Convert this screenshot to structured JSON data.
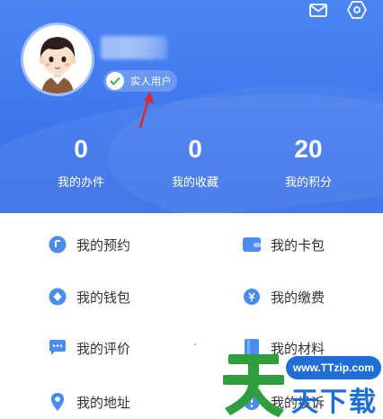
{
  "profile": {
    "verified_label": "实人用户"
  },
  "stats": [
    {
      "value": "0",
      "label": "我的办件"
    },
    {
      "value": "0",
      "label": "我的收藏"
    },
    {
      "value": "20",
      "label": "我的积分"
    }
  ],
  "menu": {
    "items": [
      {
        "label": "我的预约",
        "icon": "calendar-icon"
      },
      {
        "label": "我的卡包",
        "icon": "card-wallet-icon"
      },
      {
        "label": "我的钱包",
        "icon": "wallet-icon"
      },
      {
        "label": "我的缴费",
        "icon": "payment-icon"
      },
      {
        "label": "我的评价",
        "icon": "comment-icon"
      },
      {
        "label": "我的材料",
        "icon": "document-icon"
      },
      {
        "label": "我的地址",
        "icon": "location-icon"
      },
      {
        "label": "我的投诉",
        "icon": "complaint-icon"
      }
    ]
  },
  "watermark": {
    "big_char": "天",
    "url": "www.TTzip.com",
    "text": "天下载"
  },
  "colors": {
    "header_blue": "#3d76ec",
    "icon_blue": "#4a8cf0",
    "annotation_red": "#e0262b",
    "watermark_blue": "#1f6dd7"
  }
}
